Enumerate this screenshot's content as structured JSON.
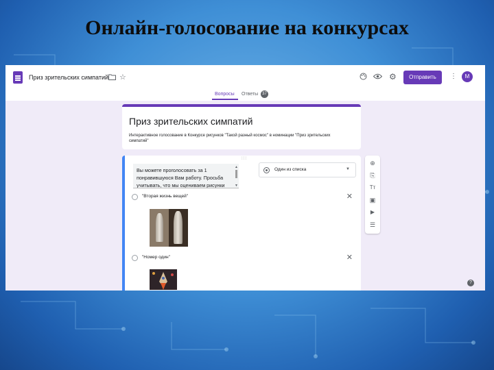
{
  "slide": {
    "title": "Онлайн-голосование на конкурсах"
  },
  "app": {
    "doc_title": "Приз зрительских симпатий",
    "send_label": "Отправить",
    "avatar_letter": "M",
    "accent_color": "#673ab7",
    "icons": [
      "forms-doc-icon",
      "folder-icon",
      "star-icon",
      "palette-icon",
      "preview-eye-icon",
      "settings-gear-icon",
      "more-vert-icon",
      "help-icon"
    ]
  },
  "tabs": {
    "questions": "Вопросы",
    "answers": "Ответы",
    "answers_count": "37"
  },
  "form": {
    "title": "Приз зрительских симпатий",
    "description": "Интерактивное голосование в Конкурсе рисунков \"Такой разный космос\" в номинации \"Приз зрительских симпатий\""
  },
  "question": {
    "text": "Вы можете проголосовать за 1 понравившуюся Вам работу. Просьба учитывать, что мы оцениваем рисунки",
    "type_label": "Один из списка",
    "options": [
      {
        "label": "\"Вторая жизнь вещей\""
      },
      {
        "label": "\"Номер один\""
      }
    ]
  },
  "side_tools": [
    "add-question-icon",
    "import-questions-icon",
    "add-title-icon",
    "add-image-icon",
    "add-video-icon",
    "add-section-icon"
  ],
  "side_glyphs": {
    "add": "⊕",
    "import": "⎘",
    "title": "Tт",
    "image": "▣",
    "video": "▶",
    "section": "☰"
  }
}
